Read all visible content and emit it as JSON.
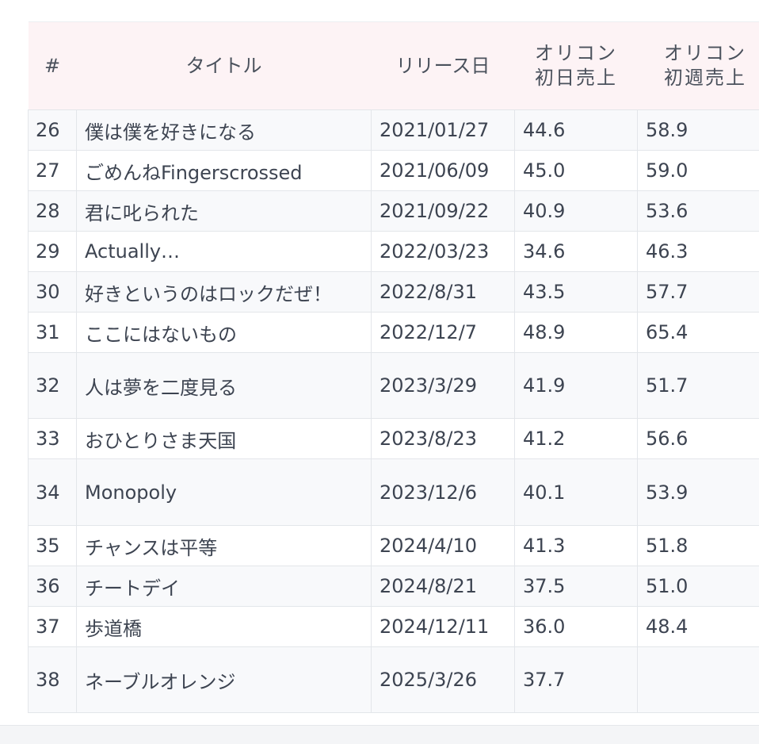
{
  "table": {
    "headers": {
      "num": "#",
      "title": "タイトル",
      "release": "リリース日",
      "oricon_day_line1": "オリコン",
      "oricon_day_line2": "初日売上",
      "oricon_week_line1": "オリコン",
      "oricon_week_line2": "初週売上"
    },
    "rows": [
      {
        "num": "26",
        "title": "僕は僕を好きになる",
        "release": "2021/01/27",
        "day": "44.6",
        "week": "58.9"
      },
      {
        "num": "27",
        "title": "ごめんねFingerscrossed",
        "release": "2021/06/09",
        "day": "45.0",
        "week": "59.0"
      },
      {
        "num": "28",
        "title": "君に叱られた",
        "release": "2021/09/22",
        "day": "40.9",
        "week": "53.6"
      },
      {
        "num": "29",
        "title": "Actually…",
        "release": "2022/03/23",
        "day": "34.6",
        "week": "46.3"
      },
      {
        "num": "30",
        "title": "好きというのはロックだぜ！",
        "release": "2022/8/31",
        "day": "43.5",
        "week": "57.7"
      },
      {
        "num": "31",
        "title": "ここにはないもの",
        "release": "2022/12/7",
        "day": "48.9",
        "week": "65.4"
      },
      {
        "num": "32",
        "title": "人は夢を二度見る",
        "release": "2023/3/29",
        "day": "41.9",
        "week": "51.7"
      },
      {
        "num": "33",
        "title": "おひとりさま天国",
        "release": "2023/8/23",
        "day": "41.2",
        "week": "56.6"
      },
      {
        "num": "34",
        "title": "Monopoly",
        "release": "2023/12/6",
        "day": "40.1",
        "week": "53.9"
      },
      {
        "num": "35",
        "title": "チャンスは平等",
        "release": "2024/4/10",
        "day": "41.3",
        "week": "51.8"
      },
      {
        "num": "36",
        "title": "チートデイ",
        "release": "2024/8/21",
        "day": "37.5",
        "week": "51.0"
      },
      {
        "num": "37",
        "title": "歩道橋",
        "release": "2024/12/11",
        "day": "36.0",
        "week": "48.4"
      },
      {
        "num": "38",
        "title": "ネーブルオレンジ",
        "release": "2025/3/26",
        "day": "37.7",
        "week": ""
      }
    ]
  }
}
